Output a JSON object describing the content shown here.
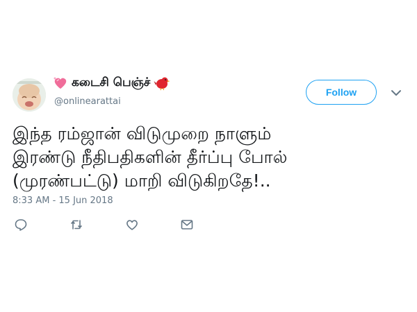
{
  "user": {
    "display_name": "கடைசி பெஞ்ச்",
    "handle": "@onlinearattai",
    "follow_label": "Follow"
  },
  "tweet": {
    "lines": [
      "இந்த ரம்ஜான் விடுமுறை நாளும்",
      "இரண்டு நீதிபதிகளின் தீர்ப்பு போல்",
      "(முரண்பட்டு) மாறி விடுகிறதே!.."
    ],
    "timestamp": "8:33 AM - 15 Jun 2018"
  },
  "actions": [
    "reply-icon",
    "retweet-icon",
    "heart-icon",
    "message-icon"
  ],
  "colors": {
    "accent": "#1da1f2",
    "text": "#14171a",
    "secondary": "#657786"
  }
}
